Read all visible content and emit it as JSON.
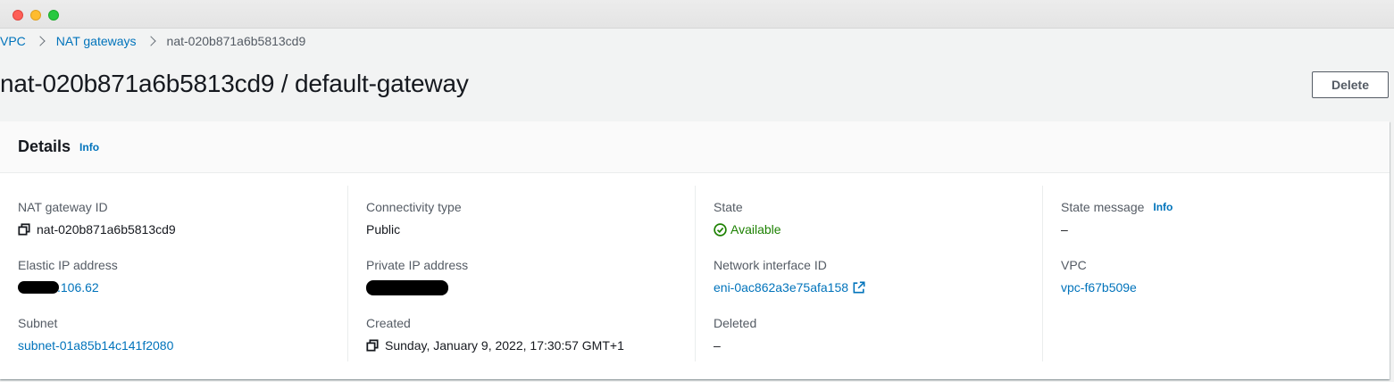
{
  "breadcrumb": {
    "items": [
      "VPC",
      "NAT gateways"
    ],
    "current": "nat-020b871a6b5813cd9"
  },
  "page": {
    "title": "nat-020b871a6b5813cd9 / default-gateway",
    "delete_label": "Delete"
  },
  "details": {
    "title": "Details",
    "info_label": "Info",
    "fields": {
      "nat_gateway_id": {
        "label": "NAT gateway ID",
        "value": "nat-020b871a6b5813cd9"
      },
      "elastic_ip": {
        "label": "Elastic IP address",
        "value": ".106.62"
      },
      "subnet": {
        "label": "Subnet",
        "value": "subnet-01a85b14c141f2080"
      },
      "connectivity_type": {
        "label": "Connectivity type",
        "value": "Public"
      },
      "private_ip": {
        "label": "Private IP address",
        "value": ""
      },
      "created": {
        "label": "Created",
        "value": "Sunday, January 9, 2022, 17:30:57 GMT+1"
      },
      "state": {
        "label": "State",
        "value": "Available"
      },
      "network_interface": {
        "label": "Network interface ID",
        "value": "eni-0ac862a3e75afa158"
      },
      "deleted": {
        "label": "Deleted",
        "value": "–"
      },
      "state_message": {
        "label": "State message",
        "info_label": "Info",
        "value": "–"
      },
      "vpc": {
        "label": "VPC",
        "value": "vpc-f67b509e"
      }
    }
  },
  "colors": {
    "link": "#0073bb",
    "success": "#1d8102",
    "background": "#f2f3f3"
  },
  "icons": [
    "copy-icon",
    "status-available-icon",
    "external-link-icon",
    "chevron-right-icon"
  ]
}
